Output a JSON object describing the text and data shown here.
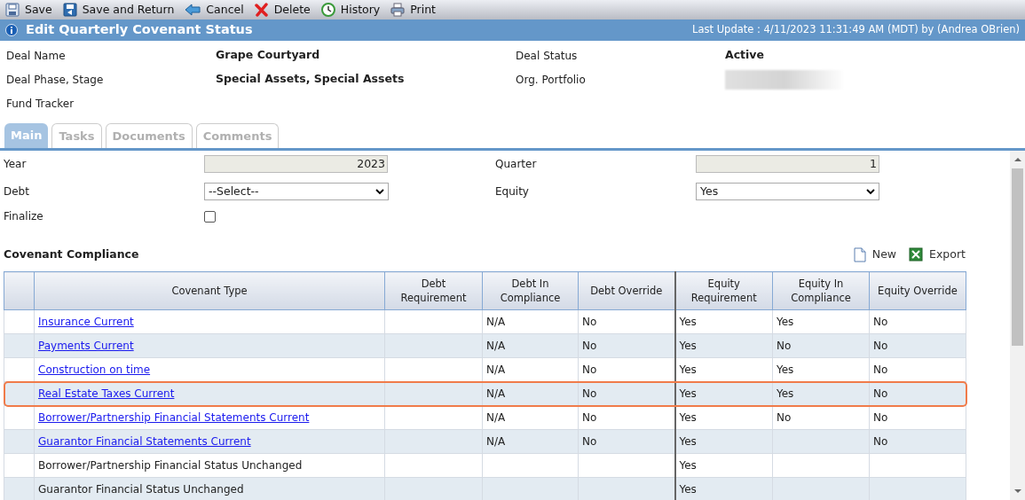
{
  "toolbar": [
    {
      "kind": "save",
      "label": "Save"
    },
    {
      "kind": "save-return",
      "label": "Save and Return"
    },
    {
      "kind": "cancel",
      "label": "Cancel"
    },
    {
      "kind": "delete",
      "label": "Delete"
    },
    {
      "kind": "history",
      "label": "History"
    },
    {
      "kind": "print",
      "label": "Print"
    }
  ],
  "title_bar": {
    "title": "Edit Quarterly Covenant Status",
    "last_update": "Last Update : 4/11/2023 11:31:49 AM (MDT) by (Andrea OBrien)"
  },
  "deal_info": [
    {
      "label": "Deal Name",
      "value": "Grape Courtyard"
    },
    {
      "label": "Deal Status",
      "value": "Active"
    },
    {
      "label": "Deal Phase, Stage",
      "value": "Special Assets, Special Assets"
    },
    {
      "label": "Org. Portfolio",
      "redacted": true
    },
    {
      "label": "Fund Tracker"
    }
  ],
  "tabs": [
    {
      "label": "Main",
      "selected": true
    },
    {
      "label": "Tasks",
      "selected": false
    },
    {
      "label": "Documents",
      "selected": false
    },
    {
      "label": "Comments",
      "selected": false
    }
  ],
  "form": {
    "year": {
      "label": "Year",
      "value": "2023"
    },
    "quarter": {
      "label": "Quarter",
      "value": "1"
    },
    "debt": {
      "label": "Debt",
      "value": "--Select--"
    },
    "equity": {
      "label": "Equity",
      "value": "Yes"
    },
    "finalize": {
      "label": "Finalize",
      "checked": false
    }
  },
  "covenant_compliance": {
    "title": "Covenant Compliance",
    "actions": [
      {
        "kind": "new",
        "label": "New"
      },
      {
        "kind": "export",
        "label": "Export"
      }
    ],
    "columns": [
      "",
      "Covenant Type",
      "Debt Requirement",
      "Debt In Compliance",
      "Debt Override",
      "Equity Requirement",
      "Equity In Compliance",
      "Equity Override"
    ],
    "rows": [
      {
        "link": true,
        "highlighted": false,
        "cells": [
          "",
          "Insurance Current",
          "",
          "N/A",
          "No",
          "Yes",
          "Yes",
          "No"
        ]
      },
      {
        "link": true,
        "highlighted": false,
        "cells": [
          "",
          "Payments Current",
          "",
          "N/A",
          "No",
          "Yes",
          "No",
          "No"
        ]
      },
      {
        "link": true,
        "highlighted": false,
        "cells": [
          "",
          "Construction on time",
          "",
          "N/A",
          "No",
          "Yes",
          "Yes",
          "No"
        ]
      },
      {
        "link": true,
        "highlighted": true,
        "cells": [
          "",
          "Real Estate Taxes Current",
          "",
          "N/A",
          "No",
          "Yes",
          "Yes",
          "No"
        ]
      },
      {
        "link": true,
        "highlighted": false,
        "cells": [
          "",
          "Borrower/Partnership Financial Statements Current",
          "",
          "N/A",
          "No",
          "Yes",
          "No",
          "No"
        ]
      },
      {
        "link": true,
        "highlighted": false,
        "cells": [
          "",
          "Guarantor Financial Statements Current",
          "",
          "N/A",
          "No",
          "Yes",
          "",
          "No"
        ]
      },
      {
        "link": false,
        "highlighted": false,
        "cells": [
          "",
          "Borrower/Partnership Financial Status Unchanged",
          "",
          "",
          "",
          "Yes",
          "",
          ""
        ]
      },
      {
        "link": false,
        "highlighted": false,
        "cells": [
          "",
          "Guarantor Financial Status Unchanged",
          "",
          "",
          "",
          "Yes",
          "",
          ""
        ]
      }
    ]
  }
}
